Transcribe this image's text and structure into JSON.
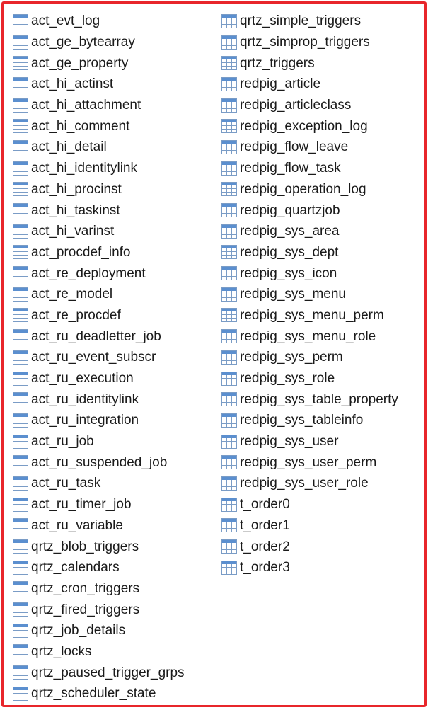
{
  "icon": "table-icon",
  "colors": {
    "frame_border": "#e8262b",
    "icon_header": "#5b8fcf",
    "icon_grid": "#7a9cc6",
    "text": "#1a1a1a"
  },
  "columns": [
    {
      "items": [
        "act_evt_log",
        "act_ge_bytearray",
        "act_ge_property",
        "act_hi_actinst",
        "act_hi_attachment",
        "act_hi_comment",
        "act_hi_detail",
        "act_hi_identitylink",
        "act_hi_procinst",
        "act_hi_taskinst",
        "act_hi_varinst",
        "act_procdef_info",
        "act_re_deployment",
        "act_re_model",
        "act_re_procdef",
        "act_ru_deadletter_job",
        "act_ru_event_subscr",
        "act_ru_execution",
        "act_ru_identitylink",
        "act_ru_integration",
        "act_ru_job",
        "act_ru_suspended_job",
        "act_ru_task",
        "act_ru_timer_job",
        "act_ru_variable",
        "qrtz_blob_triggers",
        "qrtz_calendars",
        "qrtz_cron_triggers",
        "qrtz_fired_triggers",
        "qrtz_job_details",
        "qrtz_locks",
        "qrtz_paused_trigger_grps",
        "qrtz_scheduler_state"
      ]
    },
    {
      "items": [
        "qrtz_simple_triggers",
        "qrtz_simprop_triggers",
        "qrtz_triggers",
        "redpig_article",
        "redpig_articleclass",
        "redpig_exception_log",
        "redpig_flow_leave",
        "redpig_flow_task",
        "redpig_operation_log",
        "redpig_quartzjob",
        "redpig_sys_area",
        "redpig_sys_dept",
        "redpig_sys_icon",
        "redpig_sys_menu",
        "redpig_sys_menu_perm",
        "redpig_sys_menu_role",
        "redpig_sys_perm",
        "redpig_sys_role",
        "redpig_sys_table_property",
        "redpig_sys_tableinfo",
        "redpig_sys_user",
        "redpig_sys_user_perm",
        "redpig_sys_user_role",
        "t_order0",
        "t_order1",
        "t_order2",
        "t_order3"
      ]
    }
  ]
}
